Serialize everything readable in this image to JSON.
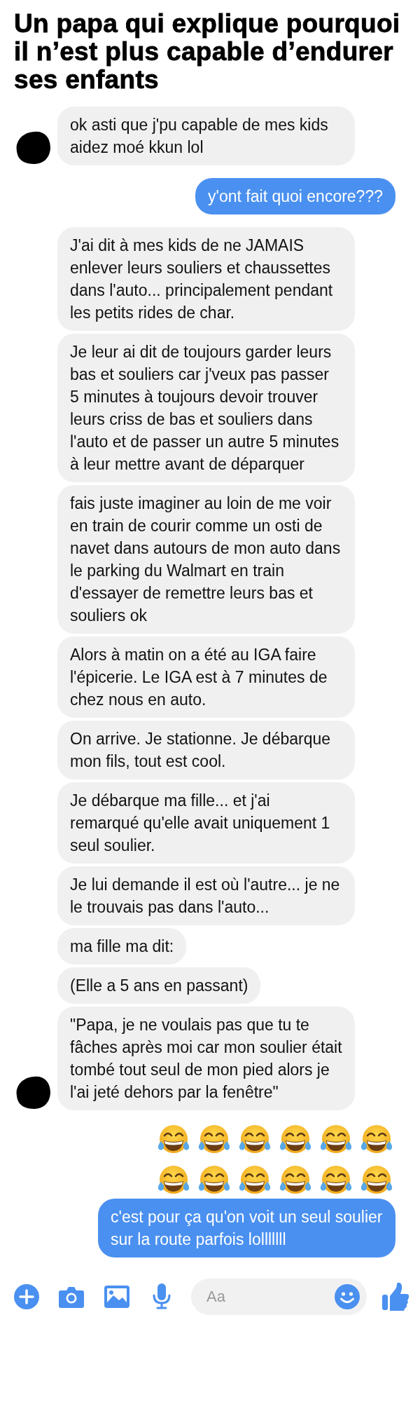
{
  "title": "Un papa qui explique pourquoi il n’est plus capable d’endurer ses enfants",
  "messages": [
    {
      "kind": "text",
      "sent": false,
      "avatar": true,
      "text": "ok asti que j'pu capable de mes kids aidez moé kkun lol"
    },
    {
      "kind": "text",
      "sent": true,
      "avatar": false,
      "text": "y'ont fait quoi encore???"
    },
    {
      "kind": "text",
      "sent": false,
      "avatar": false,
      "text": "J'ai dit à mes kids de ne JAMAIS enlever leurs souliers et chaussettes dans l'auto... principalement pendant les petits rides de char."
    },
    {
      "kind": "text",
      "sent": false,
      "avatar": false,
      "text": "Je leur ai dit de toujours garder leurs bas et souliers car j'veux pas passer 5 minutes à toujours devoir trouver leurs criss de bas et souliers dans l'auto et de passer un autre 5 minutes à leur mettre avant de déparquer"
    },
    {
      "kind": "text",
      "sent": false,
      "avatar": false,
      "text": "fais juste imaginer au loin de me voir en train de courir comme un osti de navet dans autours de mon auto dans le parking du Walmart en train d'essayer de remettre leurs bas et souliers ok"
    },
    {
      "kind": "text",
      "sent": false,
      "avatar": false,
      "text": "Alors à matin on a été au IGA faire l'épicerie. Le IGA est à 7 minutes de chez nous en auto."
    },
    {
      "kind": "text",
      "sent": false,
      "avatar": false,
      "text": "On arrive. Je stationne. Je débarque mon fils, tout est cool."
    },
    {
      "kind": "text",
      "sent": false,
      "avatar": false,
      "text": "Je débarque ma fille... et j'ai remarqué qu'elle avait uniquement 1 seul soulier."
    },
    {
      "kind": "text",
      "sent": false,
      "avatar": false,
      "text": "Je lui demande il est où l'autre... je ne le trouvais pas dans l'auto..."
    },
    {
      "kind": "text",
      "sent": false,
      "avatar": false,
      "text": "ma fille ma dit:"
    },
    {
      "kind": "text",
      "sent": false,
      "avatar": false,
      "text": "(Elle a 5 ans en passant)"
    },
    {
      "kind": "text",
      "sent": false,
      "avatar": true,
      "text": "\"Papa, je ne voulais pas que tu te fâches après moi car mon soulier était tombé tout seul de mon pied alors je l'ai jeté dehors par la fenêtre\""
    },
    {
      "kind": "emoji",
      "sent": true,
      "avatar": false,
      "emoji_rows": [
        {
          "emojis": [
            {
              "kind": "tears_of_joy"
            },
            {
              "kind": "tears_of_joy"
            },
            {
              "kind": "tears_of_joy"
            },
            {
              "kind": "tears_of_joy"
            },
            {
              "kind": "tears_of_joy"
            },
            {
              "kind": "tears_of_joy"
            }
          ]
        },
        {
          "emojis": [
            {
              "kind": "tears_of_joy"
            },
            {
              "kind": "tears_of_joy"
            },
            {
              "kind": "tears_of_joy"
            },
            {
              "kind": "tears_of_joy"
            },
            {
              "kind": "tears_of_joy"
            },
            {
              "kind": "tears_of_joy"
            }
          ]
        }
      ]
    },
    {
      "kind": "text",
      "sent": true,
      "avatar": false,
      "text": "c'est pour ça qu'on voit un seul soulier sur la route parfois lolllllll"
    }
  ],
  "composer": {
    "placeholder": "Aa"
  }
}
